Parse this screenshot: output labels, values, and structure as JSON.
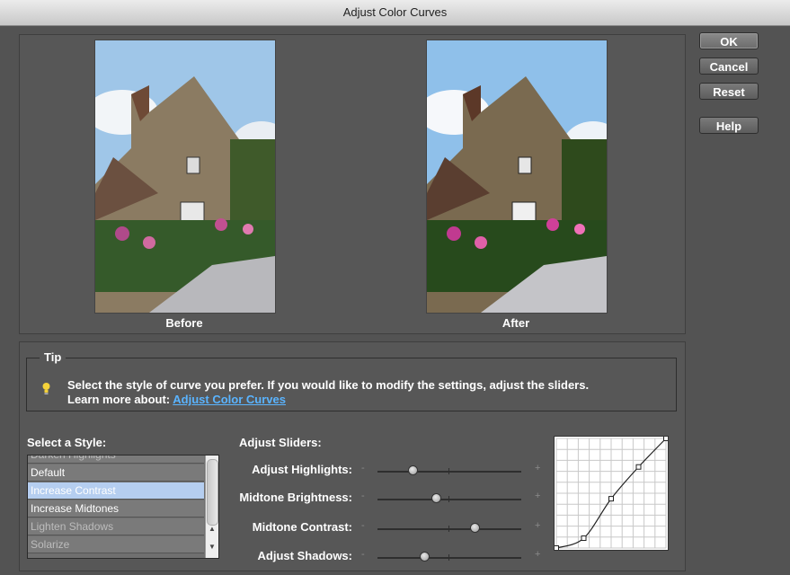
{
  "window": {
    "title": "Adjust Color Curves"
  },
  "buttons": {
    "ok": "OK",
    "cancel": "Cancel",
    "reset": "Reset",
    "help": "Help"
  },
  "preview": {
    "before_label": "Before",
    "after_label": "After"
  },
  "tip": {
    "legend": "Tip",
    "line1": "Select the style of curve you prefer. If you would like to modify the settings, adjust the sliders.",
    "learn_more": "Learn more about:",
    "link": "Adjust Color Curves"
  },
  "style_list": {
    "label": "Select a Style:",
    "items": [
      "Darken Highlights",
      "Default",
      "Increase Contrast",
      "Increase Midtones",
      "Lighten Shadows",
      "Solarize"
    ],
    "selected": "Increase Contrast"
  },
  "sliders": {
    "label": "Adjust Sliders:",
    "minus": "-",
    "plus": "+",
    "items": [
      {
        "label": "Adjust Highlights:",
        "value": 0.25
      },
      {
        "label": "Midtone Brightness:",
        "value": 0.41
      },
      {
        "label": "Midtone Contrast:",
        "value": 0.68
      },
      {
        "label": "Adjust Shadows:",
        "value": 0.33
      }
    ]
  },
  "curve": {
    "points": [
      [
        0,
        0
      ],
      [
        0.25,
        0.09
      ],
      [
        0.5,
        0.45
      ],
      [
        0.75,
        0.74
      ],
      [
        1,
        1
      ]
    ]
  },
  "colors": {
    "link": "#5ab4ff",
    "selection": "#b5cef0",
    "panel": "#575757"
  }
}
